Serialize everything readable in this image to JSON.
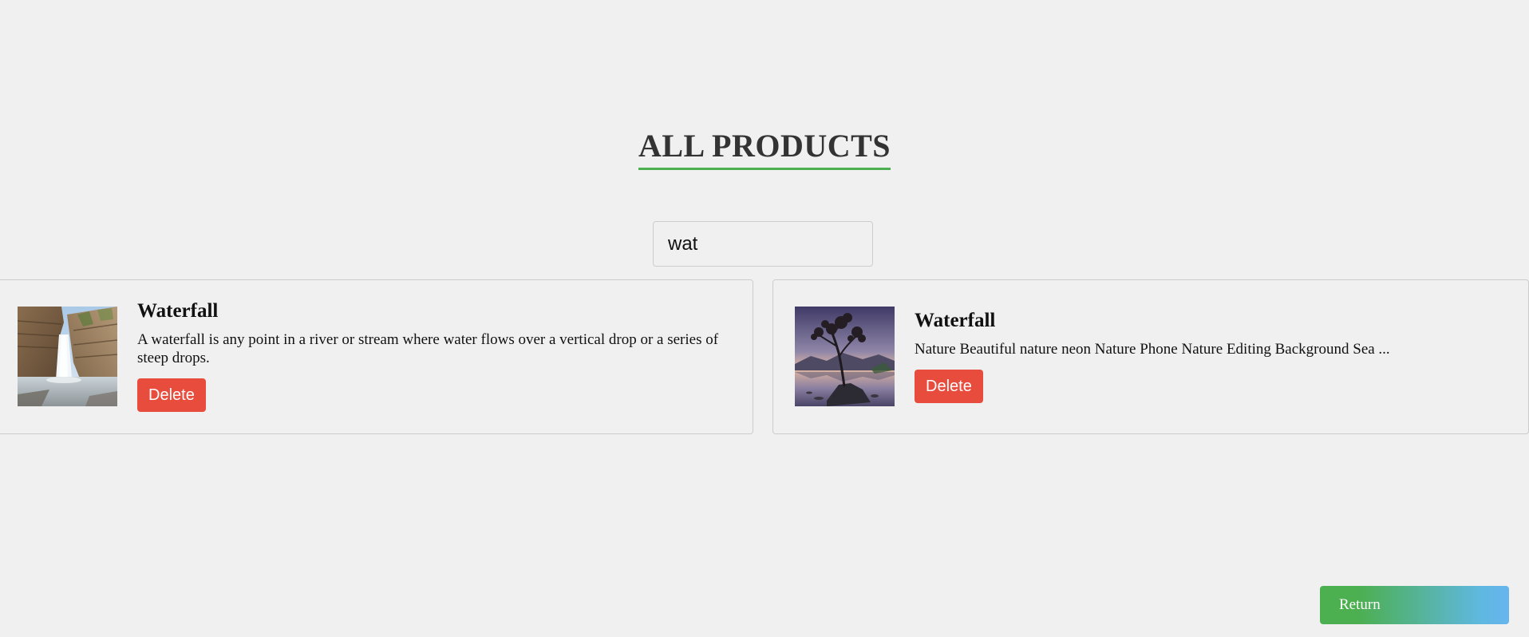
{
  "header": {
    "title": "ALL PRODUCTS",
    "accent_color": "#4caf50"
  },
  "search": {
    "value": "wat"
  },
  "products": [
    {
      "title": "Waterfall",
      "description": "A waterfall is any point in a river or stream where water flows over a vertical drop or a series of steep drops.",
      "image": "waterfall-canyon-photo",
      "delete_label": "Delete"
    },
    {
      "title": "Waterfall",
      "description": "Nature Beautiful nature neon Nature Phone Nature Editing Background Sea ...",
      "image": "lone-tree-lake-sunset-photo",
      "delete_label": "Delete"
    }
  ],
  "footer": {
    "return_label": "Return"
  },
  "colors": {
    "background": "#f0f0f0",
    "delete": "#e74c3c",
    "return_start": "#4caf50",
    "return_end": "#67b5ee"
  }
}
